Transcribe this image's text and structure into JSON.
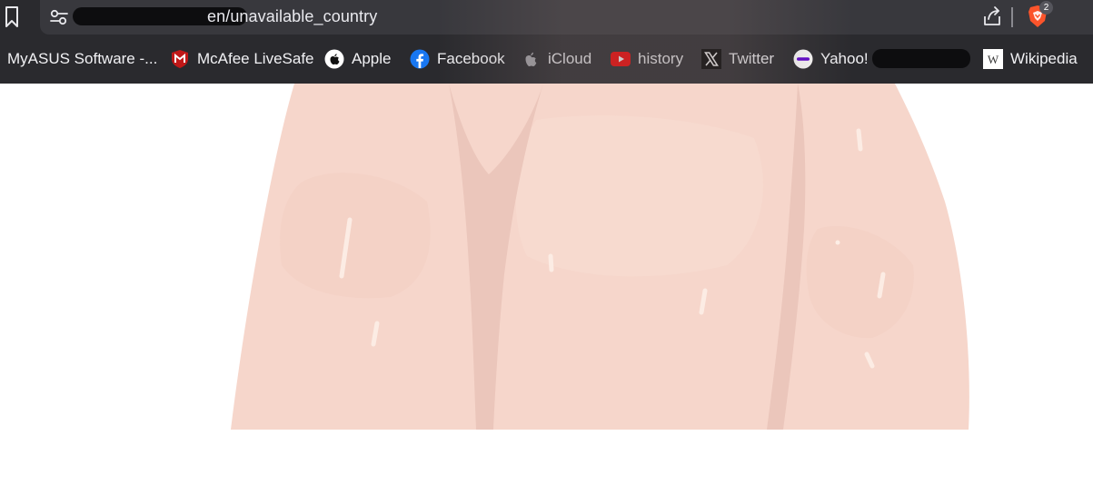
{
  "browser": {
    "address_bar": {
      "url_visible_text": "en/unavailable_country"
    },
    "brave_shield": {
      "badge_count": "2"
    },
    "bookmarks": [
      {
        "label": "MyASUS Software -...",
        "icon": "none"
      },
      {
        "label": "McAfee LiveSafe",
        "icon": "mcafee-icon"
      },
      {
        "label": "Apple",
        "icon": "apple-icon"
      },
      {
        "label": "Facebook",
        "icon": "facebook-icon"
      },
      {
        "label": "iCloud",
        "icon": "icloud-apple-icon"
      },
      {
        "label": "history",
        "icon": "youtube-icon"
      },
      {
        "label": "Twitter",
        "icon": "x-icon"
      },
      {
        "label": "Yahoo!",
        "icon": "yahoo-icon"
      },
      {
        "label": "Wikipedia",
        "icon": "wikipedia-icon"
      }
    ]
  },
  "colors": {
    "chrome_bg": "#2a2a2e",
    "address_bg": "#38383d",
    "illustration_skin": "#f6d6cb",
    "illustration_fold": "#ebc6bb",
    "highlight": "#fdeee6"
  }
}
